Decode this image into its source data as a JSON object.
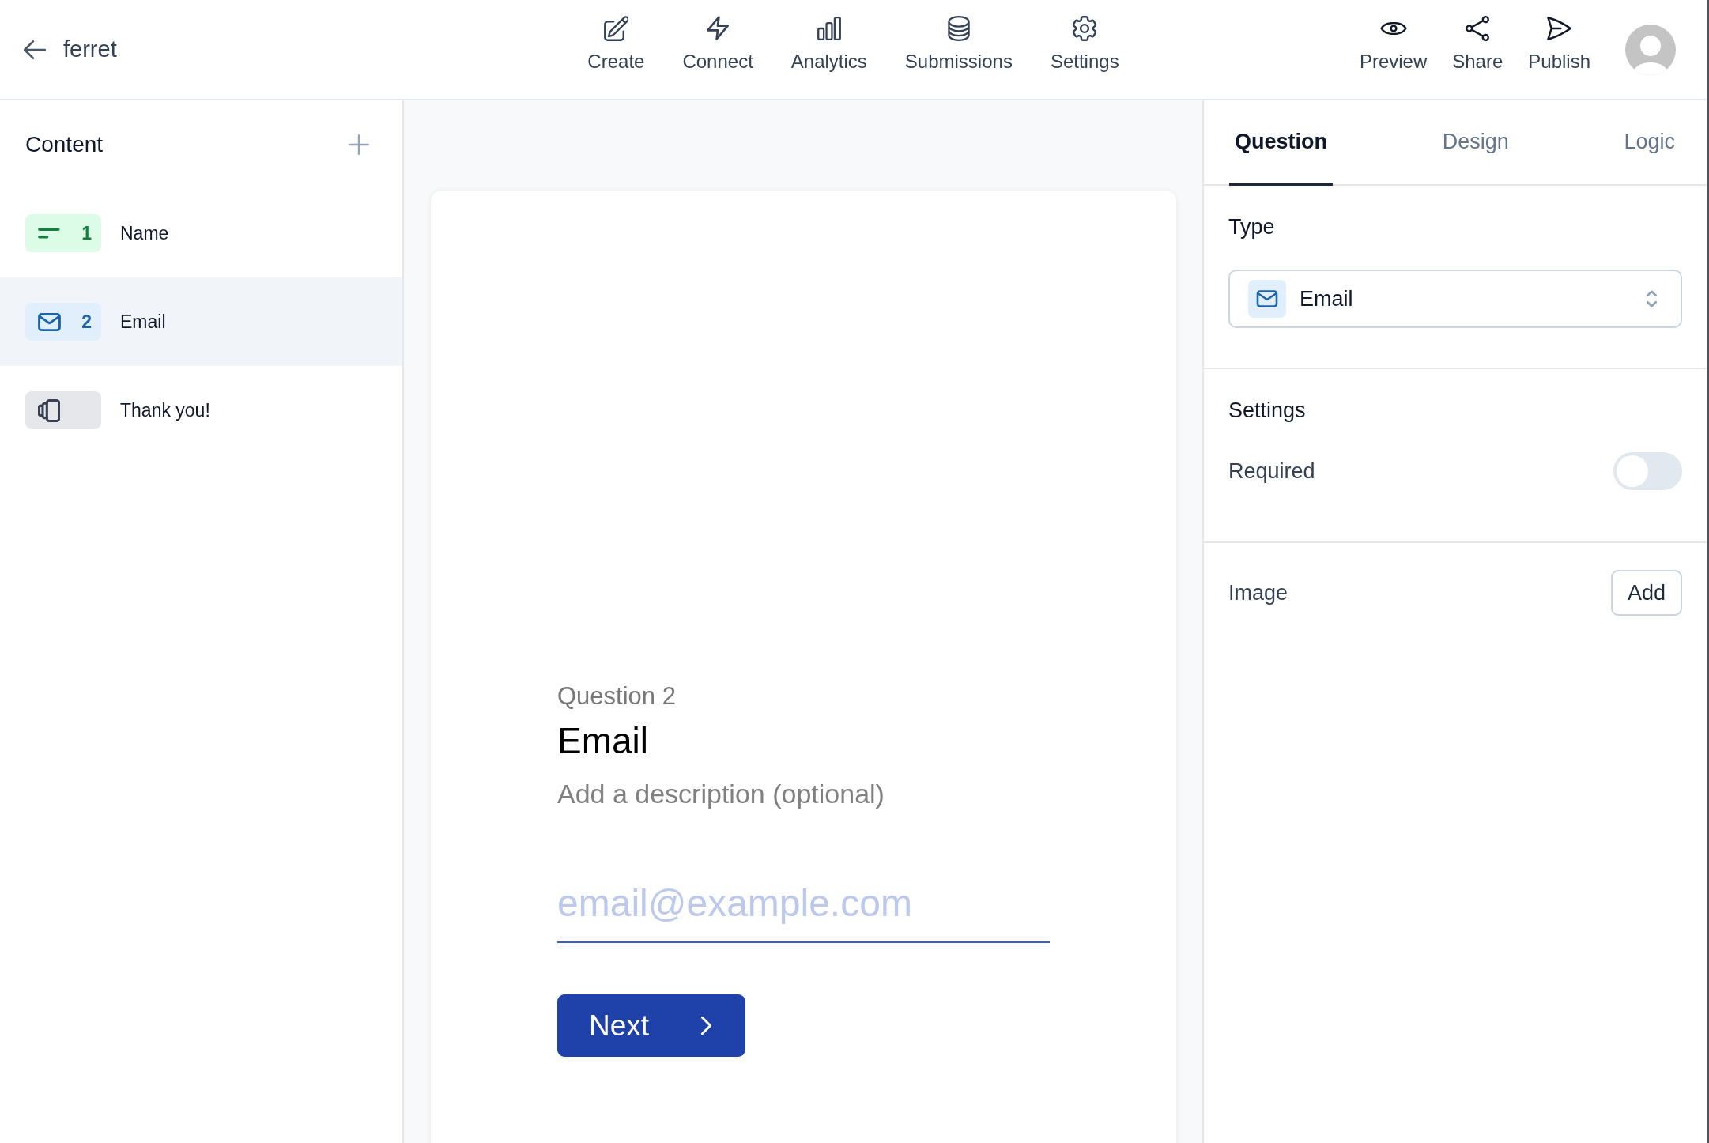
{
  "header": {
    "title": "ferret",
    "nav": [
      {
        "label": "Create"
      },
      {
        "label": "Connect"
      },
      {
        "label": "Analytics"
      },
      {
        "label": "Submissions"
      },
      {
        "label": "Settings"
      }
    ],
    "actions": [
      {
        "label": "Preview"
      },
      {
        "label": "Share"
      },
      {
        "label": "Publish"
      }
    ]
  },
  "sidebar": {
    "title": "Content",
    "items": [
      {
        "kind": "short_text",
        "number": "1",
        "label": "Name",
        "selected": false
      },
      {
        "kind": "email",
        "number": "2",
        "label": "Email",
        "selected": true
      },
      {
        "kind": "ending",
        "label": "Thank you!",
        "selected": false
      }
    ]
  },
  "preview": {
    "eyebrow": "Question 2",
    "title": "Email",
    "description": "Add a description (optional)",
    "input": {
      "placeholder": "email@example.com"
    },
    "next_button": "Next"
  },
  "inspector": {
    "tabs": [
      {
        "label": "Question",
        "selected": true
      },
      {
        "label": "Design",
        "selected": false
      },
      {
        "label": "Logic",
        "selected": false
      }
    ],
    "type": {
      "label": "Type",
      "kind": "email",
      "value": "Email"
    },
    "settings": {
      "title": "Settings",
      "required": {
        "label": "Required",
        "on": false
      }
    },
    "image": {
      "label": "Image",
      "button": "Add"
    }
  }
}
